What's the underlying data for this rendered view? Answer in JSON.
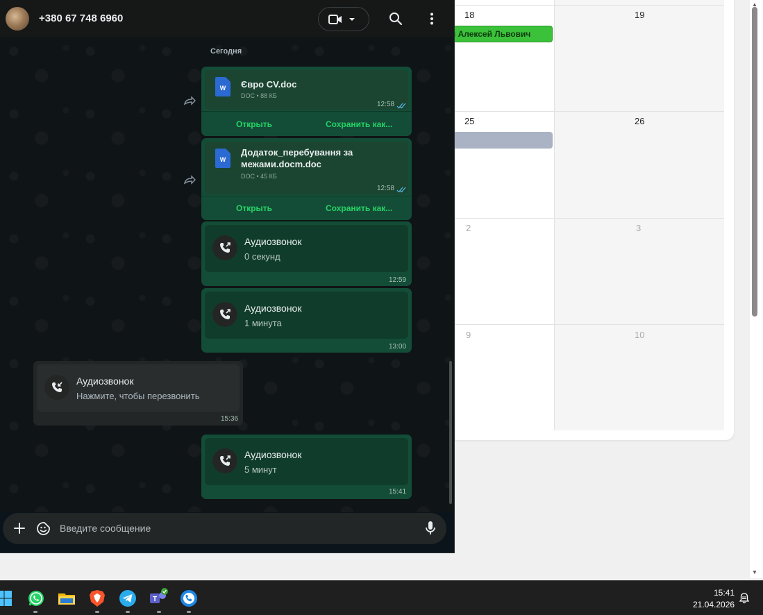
{
  "calendar": {
    "dates": {
      "d18": "18",
      "d19": "19",
      "d25": "25",
      "d26": "26",
      "d2": "2",
      "d3": "3",
      "d9": "9",
      "d10": "10"
    },
    "event_label": "н Алексей Львович"
  },
  "chat": {
    "contact_name": "+380 67 748 6960",
    "date_separator": "Сегодня",
    "messages": [
      {
        "type": "document",
        "file_name": "Євро CV.doc",
        "file_meta": "DOC • 88 КБ",
        "time": "12:58",
        "open_label": "Открыть",
        "save_label": "Сохранить как..."
      },
      {
        "type": "document",
        "file_name": "Додаток_перебування за межами.docm.doc",
        "file_meta": "DOC • 45 КБ",
        "time": "12:58",
        "open_label": "Открыть",
        "save_label": "Сохранить как..."
      },
      {
        "type": "call",
        "title": "Аудиозвонок",
        "subtitle": "0 секунд",
        "time": "12:59"
      },
      {
        "type": "call",
        "title": "Аудиозвонок",
        "subtitle": "1 минута",
        "time": "13:00"
      },
      {
        "type": "call",
        "title": "Аудиозвонок",
        "subtitle": "Нажмите, чтобы перезвонить",
        "time": "15:36"
      },
      {
        "type": "call",
        "title": "Аудиозвонок",
        "subtitle": "5 минут",
        "time": "15:41"
      }
    ],
    "composer_placeholder": "Введите сообщение",
    "doc_icon_letter": "W"
  },
  "taskbar": {
    "items": [
      "windows-start",
      "whatsapp",
      "file-explorer",
      "brave-browser",
      "telegram",
      "teams",
      "phone-link"
    ],
    "time": "15:41",
    "date": "21.04.2026"
  },
  "colors": {
    "outgoing_bubble": "#144d37",
    "incoming_bubble": "#232626",
    "accent_green": "#25d366",
    "calendar_event_green": "#3cc13b"
  }
}
